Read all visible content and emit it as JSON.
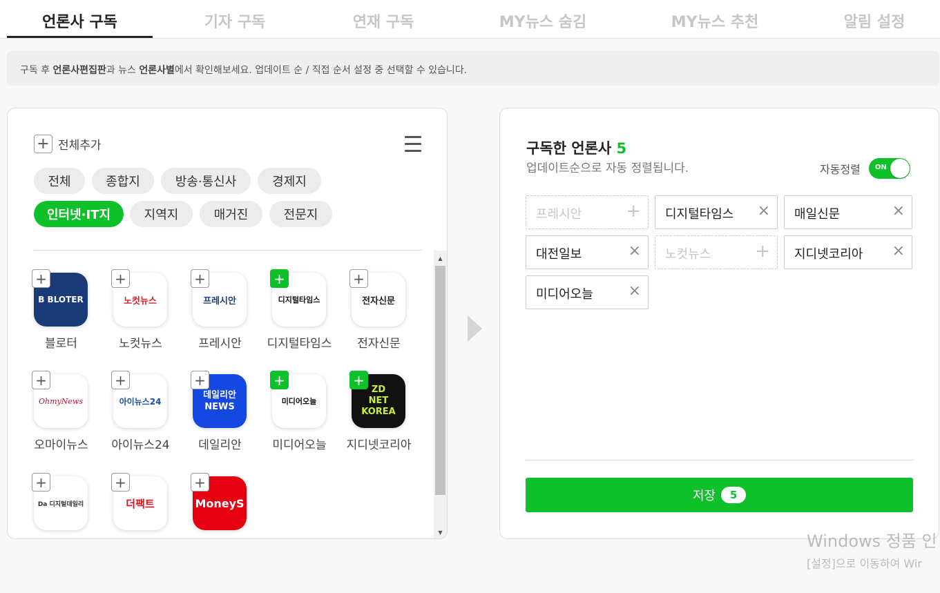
{
  "tabs": [
    {
      "label": "언론사 구독",
      "active": true
    },
    {
      "label": "기자 구독"
    },
    {
      "label": "연재 구독"
    },
    {
      "label": "MY뉴스 숨김"
    },
    {
      "label": "MY뉴스 추천"
    },
    {
      "label": "알림 설정"
    }
  ],
  "notice": {
    "p1": "구독 후 ",
    "b1": "언론사편집판",
    "p2": "과 뉴스 ",
    "b2": "언론사별",
    "p3": "에서 확인해보세요. 업데이트 순 / 직접 순서 설정 중 선택할 수 있습니다."
  },
  "left": {
    "add_all_label": "전체추가",
    "categories": [
      "전체",
      "종합지",
      "방송·통신사",
      "경제지",
      "인터넷·IT지",
      "지역지",
      "매거진",
      "전문지"
    ],
    "active_category": "인터넷·IT지",
    "press": [
      {
        "name": "블로터",
        "logo": "B BLOTER",
        "added": false
      },
      {
        "name": "노컷뉴스",
        "logo": "노컷뉴스",
        "added": false
      },
      {
        "name": "프레시안",
        "logo": "프레시안",
        "added": false
      },
      {
        "name": "디지털타임스",
        "logo": "디지털타임스",
        "added": true
      },
      {
        "name": "전자신문",
        "logo": "전자신문",
        "added": false
      },
      {
        "name": "오마이뉴스",
        "logo": "OhmyNews",
        "added": false
      },
      {
        "name": "아이뉴스24",
        "logo": "아이뉴스24",
        "added": false
      },
      {
        "name": "데일리안",
        "logo": "데일리안 NEWS",
        "added": false
      },
      {
        "name": "미디어오늘",
        "logo": "미디어오늘",
        "added": true
      },
      {
        "name": "지디넷코리아",
        "logo": "ZD NET KOREA",
        "added": true
      },
      {
        "name": "",
        "logo": "Da 디지털데일리",
        "added": false
      },
      {
        "name": "",
        "logo": "더팩트",
        "added": false
      },
      {
        "name": "",
        "logo": "MoneyS",
        "added": false
      }
    ]
  },
  "right": {
    "title": "구독한 언론사",
    "count": "5",
    "subtitle": "업데이트순으로 자동 정렬됩니다.",
    "autosort_label": "자동정렬",
    "toggle_label": "ON",
    "slots": [
      {
        "name": "프레시안",
        "empty": true
      },
      {
        "name": "디지털타임스",
        "empty": false
      },
      {
        "name": "매일신문",
        "empty": false
      },
      {
        "name": "대전일보",
        "empty": false
      },
      {
        "name": "노컷뉴스",
        "empty": true
      },
      {
        "name": "지디넷코리아",
        "empty": false
      },
      {
        "name": "미디어오늘",
        "empty": false
      }
    ],
    "save_label": "저장",
    "save_count": "5"
  },
  "watermark": {
    "line1": "Windows 정품 인",
    "line2": "[설정]으로 이동하여 Wir"
  },
  "colors": {
    "accent": "#0ec12a"
  }
}
